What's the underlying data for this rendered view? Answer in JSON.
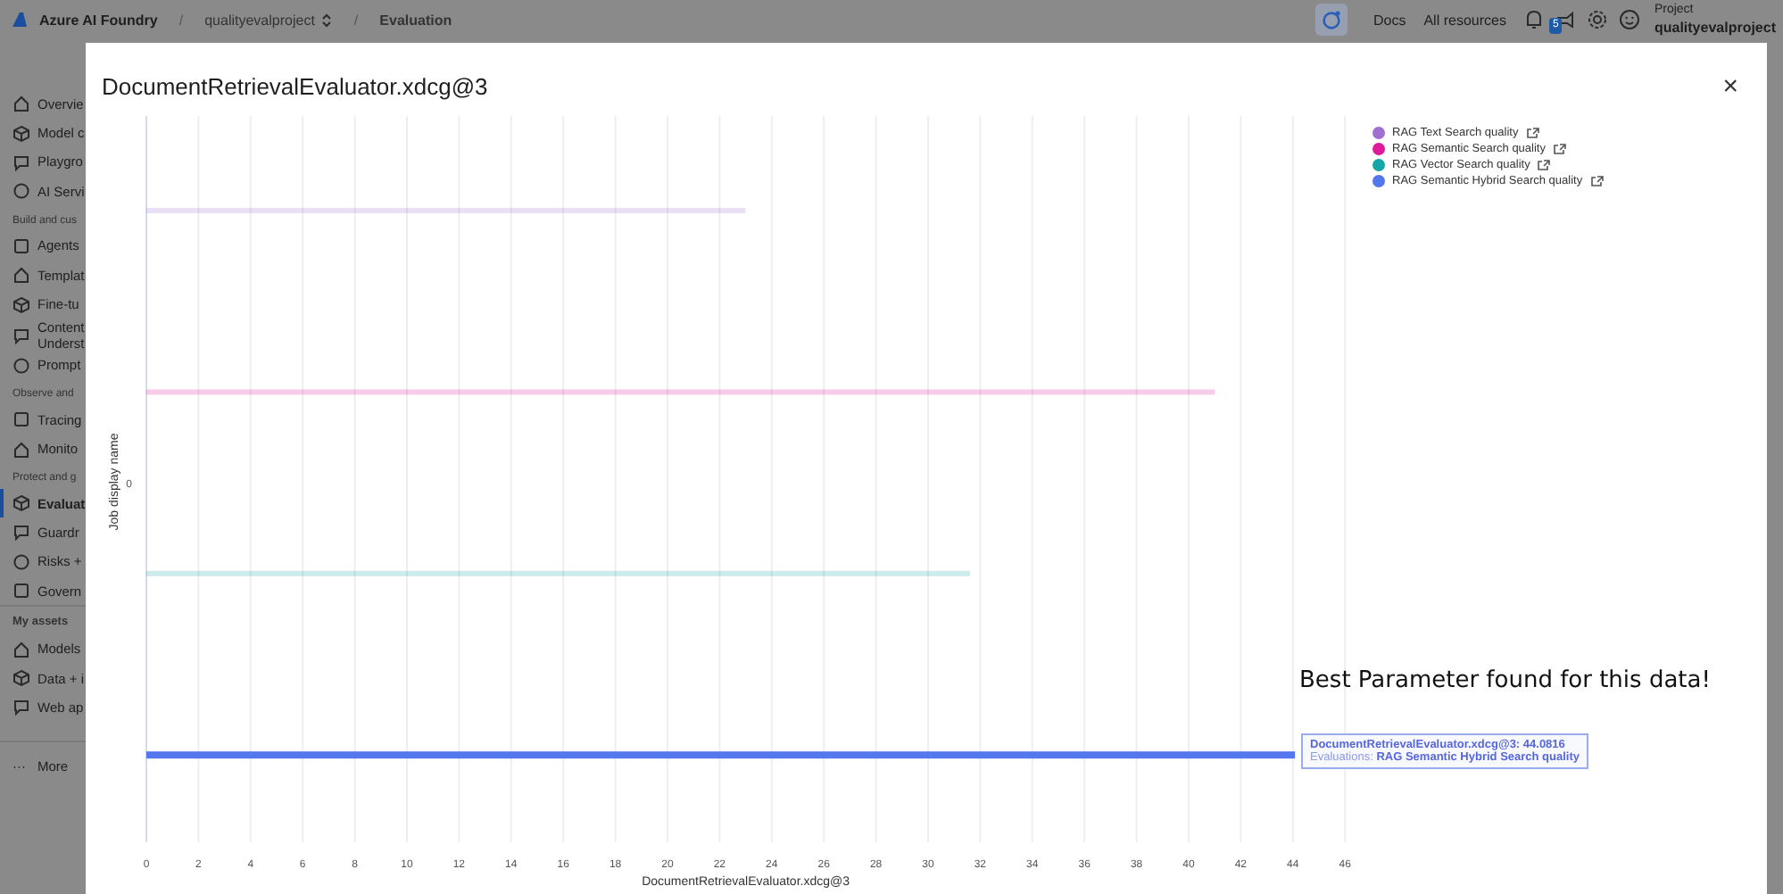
{
  "top_bar": {
    "brand": "Azure AI Foundry",
    "separator": "/",
    "breadcrumbs": [
      {
        "label": "qualityevalproject",
        "kind": "switcher"
      },
      {
        "label": "Evaluation",
        "kind": "current"
      }
    ],
    "links": [
      "Docs",
      "All resources"
    ],
    "notification_badge": "5",
    "project_caption": "Project",
    "project_name": "qualityevalproject"
  },
  "sidebar": {
    "sections": [
      {
        "items": [
          {
            "label": "Overvie",
            "selected": false
          },
          {
            "label": "Model c",
            "selected": false
          },
          {
            "label": "Playgro",
            "selected": false
          },
          {
            "label": "AI Servi",
            "selected": false
          }
        ]
      },
      {
        "heading": "Build and cus",
        "items": [
          {
            "label": "Agents",
            "selected": false
          },
          {
            "label": "Templat",
            "selected": false
          },
          {
            "label": "Fine-tu",
            "selected": false
          },
          {
            "label": "Content\nUnderst",
            "selected": false
          },
          {
            "label": "Prompt",
            "selected": false
          }
        ]
      },
      {
        "heading": "Observe and",
        "items": [
          {
            "label": "Tracing",
            "selected": false
          },
          {
            "label": "Monito",
            "selected": false
          }
        ]
      },
      {
        "heading": "Protect and g",
        "items": [
          {
            "label": "Evaluat",
            "selected": true
          },
          {
            "label": "Guardr",
            "selected": false
          },
          {
            "label": "Risks +",
            "selected": false
          },
          {
            "label": "Govern",
            "selected": false
          }
        ]
      },
      {
        "heading": "My assets",
        "items": [
          {
            "label": "Models",
            "selected": false
          },
          {
            "label": "Data + i",
            "selected": false
          },
          {
            "label": "Web ap",
            "selected": false
          }
        ]
      }
    ],
    "more": {
      "icon_text": "···",
      "label": "More"
    }
  },
  "dialog": {
    "title": "DocumentRetrievalEvaluator.xdcg@3",
    "close": "×",
    "annotation": "Best Parameter found for this data!",
    "bar_states": [
      {
        "faded": true
      },
      {
        "faded": true
      },
      {
        "faded": true
      },
      {
        "faded": false
      }
    ],
    "tooltip": {
      "title": "DocumentRetrievalEvaluator.xdcg@3: 44.0816",
      "text": "Evaluations: **RAG Semantic Hybrid Search quality**"
    },
    "chart_data": {
      "type": "bar",
      "orientation": "horizontal",
      "xlabel": "DocumentRetrievalEvaluator.xdcg@3",
      "ylabel": "Job display name",
      "categories": [
        "0"
      ],
      "series": [
        {
          "name": "RAG Text Search quality",
          "color": "#a070d0",
          "values": [
            23
          ]
        },
        {
          "name": "RAG Semantic Search quality",
          "color": "#e0189a",
          "values": [
            41
          ]
        },
        {
          "name": "RAG Vector Search quality",
          "color": "#16a6a6",
          "values": [
            31.6
          ]
        },
        {
          "name": "RAG Semantic Hybrid Search quality",
          "color": "#5577ee",
          "values": [
            44.08
          ]
        }
      ],
      "xlim": [
        0,
        46
      ],
      "grid": true,
      "xticks": [
        0,
        2,
        4,
        6,
        8,
        10,
        12,
        14,
        16,
        18,
        20,
        22,
        24,
        26,
        28,
        30,
        32,
        34,
        36,
        38,
        40,
        42,
        44,
        46
      ]
    }
  }
}
